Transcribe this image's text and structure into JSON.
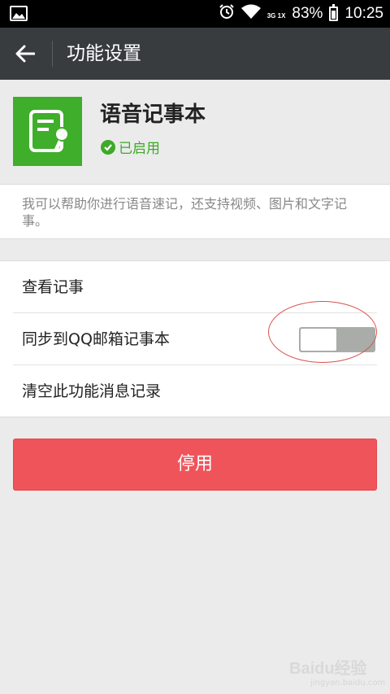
{
  "status_bar": {
    "network": "3G 1X",
    "battery": "83%",
    "time": "10:25"
  },
  "header": {
    "title": "功能设置"
  },
  "plugin": {
    "name": "语音记事本",
    "status": "已启用"
  },
  "description": "我可以帮助你进行语音速记，还支持视频、图片和文字记事。",
  "menu": {
    "items": [
      {
        "label": "查看记事"
      },
      {
        "label": "同步到QQ邮箱记事本",
        "toggle": false
      },
      {
        "label": "清空此功能消息记录"
      }
    ]
  },
  "disable_button": "停用",
  "watermark": {
    "text": "Baidu经验",
    "sub": "jingyan.baidu.com"
  },
  "colors": {
    "title_bar": "#383c3f",
    "accent_green": "#3fae2a",
    "danger": "#f0545b"
  }
}
